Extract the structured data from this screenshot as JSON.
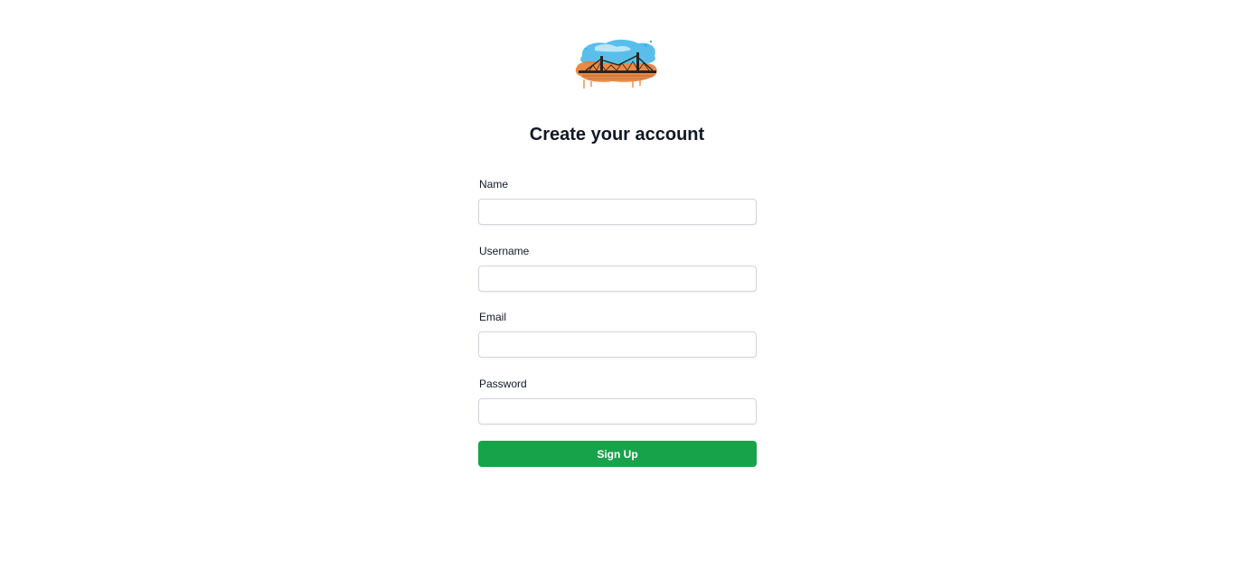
{
  "logo": {
    "icon": "bridge-watercolor-logo",
    "colors": {
      "sky": "#3cb4e6",
      "sunset": "#e87a2c",
      "bridge": "#2a2320"
    }
  },
  "title": "Create your account",
  "form": {
    "fields": [
      {
        "label": "Name",
        "value": "",
        "type": "text"
      },
      {
        "label": "Username",
        "value": "",
        "type": "text"
      },
      {
        "label": "Email",
        "value": "",
        "type": "email"
      },
      {
        "label": "Password",
        "value": "",
        "type": "password"
      }
    ],
    "submit_label": "Sign Up"
  },
  "colors": {
    "accent": "#17a34a",
    "text": "#111827",
    "border": "#d1d5db"
  }
}
